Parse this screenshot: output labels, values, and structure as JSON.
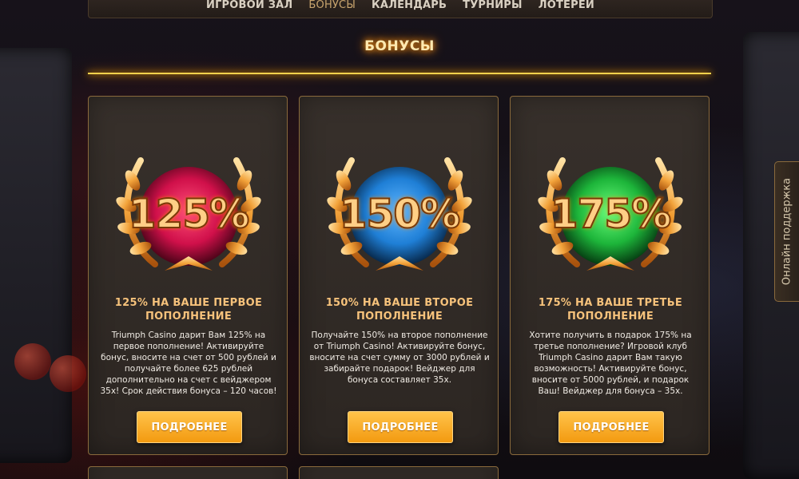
{
  "nav": {
    "items": [
      {
        "label": "ИГРОВОЙ ЗАЛ",
        "active": false
      },
      {
        "label": "БОНУСЫ",
        "active": true
      },
      {
        "label": "КАЛЕНДАРЬ",
        "active": false
      },
      {
        "label": "ТУРНИРЫ",
        "active": false
      },
      {
        "label": "ЛОТЕРЕИ",
        "active": false
      }
    ]
  },
  "page": {
    "title": "БОНУСЫ"
  },
  "bonuses": [
    {
      "percent": "125%",
      "title": "125% НА ВАШЕ ПЕРВОЕ ПОПОЛНЕНИЕ",
      "text": "Triumph Casino дарит Вам 125% на первое пополнение! Активируйте бонус, вносите на счет от 500 рублей и получайте более 625 рублей дополнительно на счет с вейджером 35х! Срок действия бонуса – 120 часов!",
      "button": "ПОДРОБНЕЕ",
      "orb_color": "#d0104a"
    },
    {
      "percent": "150%",
      "title": "150% НА ВАШЕ ВТОРОЕ ПОПОЛНЕНИЕ",
      "text": "Получайте 150% на второе пополнение от Triumph Casino! Активируйте бонус, вносите на счет сумму от 3000 рублей и забирайте подарок! Вейджер для бонуса составляет 35х.",
      "button": "ПОДРОБНЕЕ",
      "orb_color": "#1f7fd6"
    },
    {
      "percent": "175%",
      "title": "175% НА ВАШЕ ТРЕТЬЕ ПОПОЛНЕНИЕ",
      "text": "Хотите получить в подарок 175% на третье пополнение? Игровой клуб Triumph Casino дарит Вам такую возможность! Активируйте бонус, вносите от 5000 рублей, и подарок Ваш! Вейджер для бонуса – 35х.",
      "button": "ПОДРОБНЕЕ",
      "orb_color": "#1db53a"
    }
  ],
  "support": {
    "label": "Онлайн поддержка"
  },
  "colors": {
    "accent": "#ffd34d",
    "button": "#f39a10",
    "card_border": "#8a6a3c"
  }
}
